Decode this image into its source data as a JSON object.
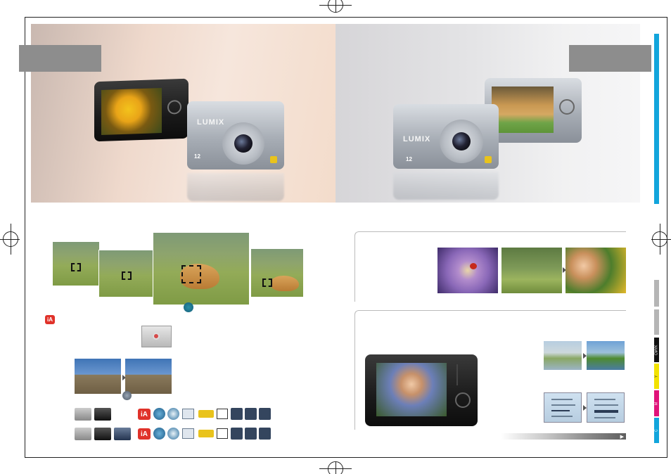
{
  "brand": {
    "camera_badge": "LUMIX",
    "megapixel_badge": "12"
  },
  "icons": {
    "ia_label": "iA",
    "nav_arrow": "▶"
  },
  "side_tabs": [
    {
      "label": "CMYK",
      "color": "#111111"
    },
    {
      "label": "Y",
      "color": "#f2e200"
    },
    {
      "label": "M",
      "color": "#e0137a"
    },
    {
      "label": "C",
      "color": "#12a5dc"
    }
  ],
  "colors": {
    "accent_cyan": "#12a5dc",
    "ia_red": "#e0322a",
    "grey_box": "#8d8d8d"
  }
}
